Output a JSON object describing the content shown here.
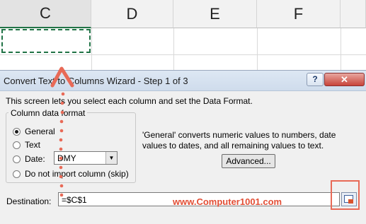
{
  "sheet": {
    "columns": [
      "C",
      "D",
      "E",
      "F"
    ]
  },
  "dialog": {
    "title": "Convert Text to Columns Wizard - Step 1 of 3",
    "help_label": "?",
    "close_label": "✕",
    "intro": "This screen lets you select each column and set the Data Format.",
    "group_title": "Column data format",
    "options": [
      {
        "label": "General",
        "checked": true
      },
      {
        "label": "Text",
        "checked": false
      },
      {
        "label": "Date:",
        "checked": false
      },
      {
        "label": "Do not import column (skip)",
        "checked": false
      }
    ],
    "date_format": "DMY",
    "description": "'General' converts numeric values to numbers, date values to dates, and all remaining values to text.",
    "advanced_label": "Advanced...",
    "destination_label": "Destination:",
    "destination_value": "=$C$1",
    "watermark": "www.Computer1001.com"
  },
  "colors": {
    "accent": "#217346",
    "annotation": "#e86a57"
  }
}
